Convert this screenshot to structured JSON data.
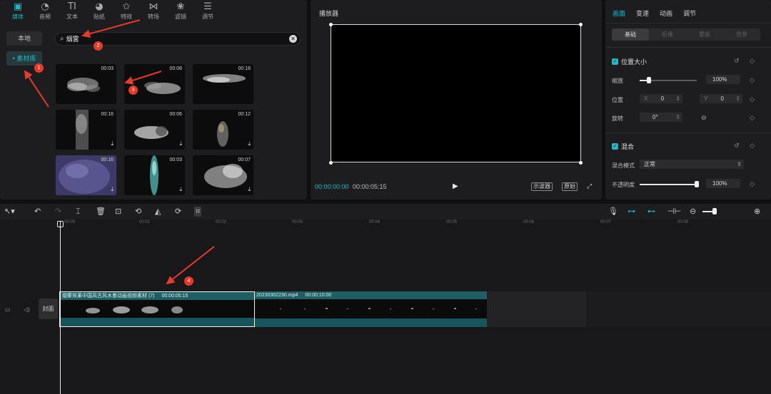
{
  "media": {
    "tabs": [
      {
        "label": "媒体",
        "icon": "media-icon",
        "glyph": "▣"
      },
      {
        "label": "音频",
        "icon": "audio-icon",
        "glyph": "◔"
      },
      {
        "label": "文本",
        "icon": "text-icon",
        "glyph": "TI"
      },
      {
        "label": "贴纸",
        "icon": "sticker-icon",
        "glyph": "◕"
      },
      {
        "label": "特效",
        "icon": "effects-icon",
        "glyph": "✩"
      },
      {
        "label": "转场",
        "icon": "transition-icon",
        "glyph": "⋈"
      },
      {
        "label": "滤镜",
        "icon": "filter-icon",
        "glyph": "❀"
      },
      {
        "label": "调节",
        "icon": "adjust-icon",
        "glyph": "☰"
      }
    ],
    "side": {
      "local": "本地",
      "library": "素材库"
    },
    "search_value": "烟雾",
    "thumbnails": [
      {
        "duration": "00:03",
        "download": ""
      },
      {
        "duration": "00:08",
        "download": ""
      },
      {
        "duration": "00:18",
        "download": ""
      },
      {
        "duration": "00:16",
        "download": "⤓"
      },
      {
        "duration": "00:06",
        "download": "⤓"
      },
      {
        "duration": "00:12",
        "download": "⤓"
      },
      {
        "duration": "00:16",
        "download": "⤓"
      },
      {
        "duration": "00:03",
        "download": "⤓"
      },
      {
        "duration": "00:07",
        "download": "⤓"
      }
    ]
  },
  "player": {
    "title": "播放器",
    "time_current": "00:00:00:00",
    "time_total": "00:00:05:15",
    "btn_ratio": "示波器",
    "btn_original": "原始"
  },
  "props": {
    "tabs": [
      "画面",
      "变速",
      "动画",
      "调节"
    ],
    "segments": [
      "基础",
      "抠像",
      "蒙版",
      "背景"
    ],
    "section_position": "位置大小",
    "scale_label": "缩放",
    "scale_value": "100%",
    "position_label": "位置",
    "pos_x_label": "X",
    "pos_x": "0",
    "pos_y_label": "Y",
    "pos_y": "0",
    "rotate_label": "旋转",
    "rotate_value": "0°",
    "section_blend": "混合",
    "blend_mode_label": "混合模式",
    "blend_mode_value": "正常",
    "opacity_label": "不透明度",
    "opacity_value": "100%",
    "scale_level": 0.16,
    "opacity_level": 1.0
  },
  "timeline": {
    "ticks": [
      "00:00",
      "00:01",
      "00:02",
      "00:03",
      "00:04",
      "00:05",
      "00:06",
      "00:07",
      "00:08"
    ],
    "cover_label": "封面",
    "clip1_title": "烟雾效果中国风古风水墨动画视频素材 (7)",
    "clip1_duration": "00:00:05:15",
    "clip2_title": "20230302230.mp4",
    "clip2_duration": "00:00:10:00"
  },
  "annotations": [
    "1",
    "2",
    "3",
    "4"
  ],
  "colors": {
    "accent": "#25b7c8",
    "arrow": "#e33b2c"
  }
}
